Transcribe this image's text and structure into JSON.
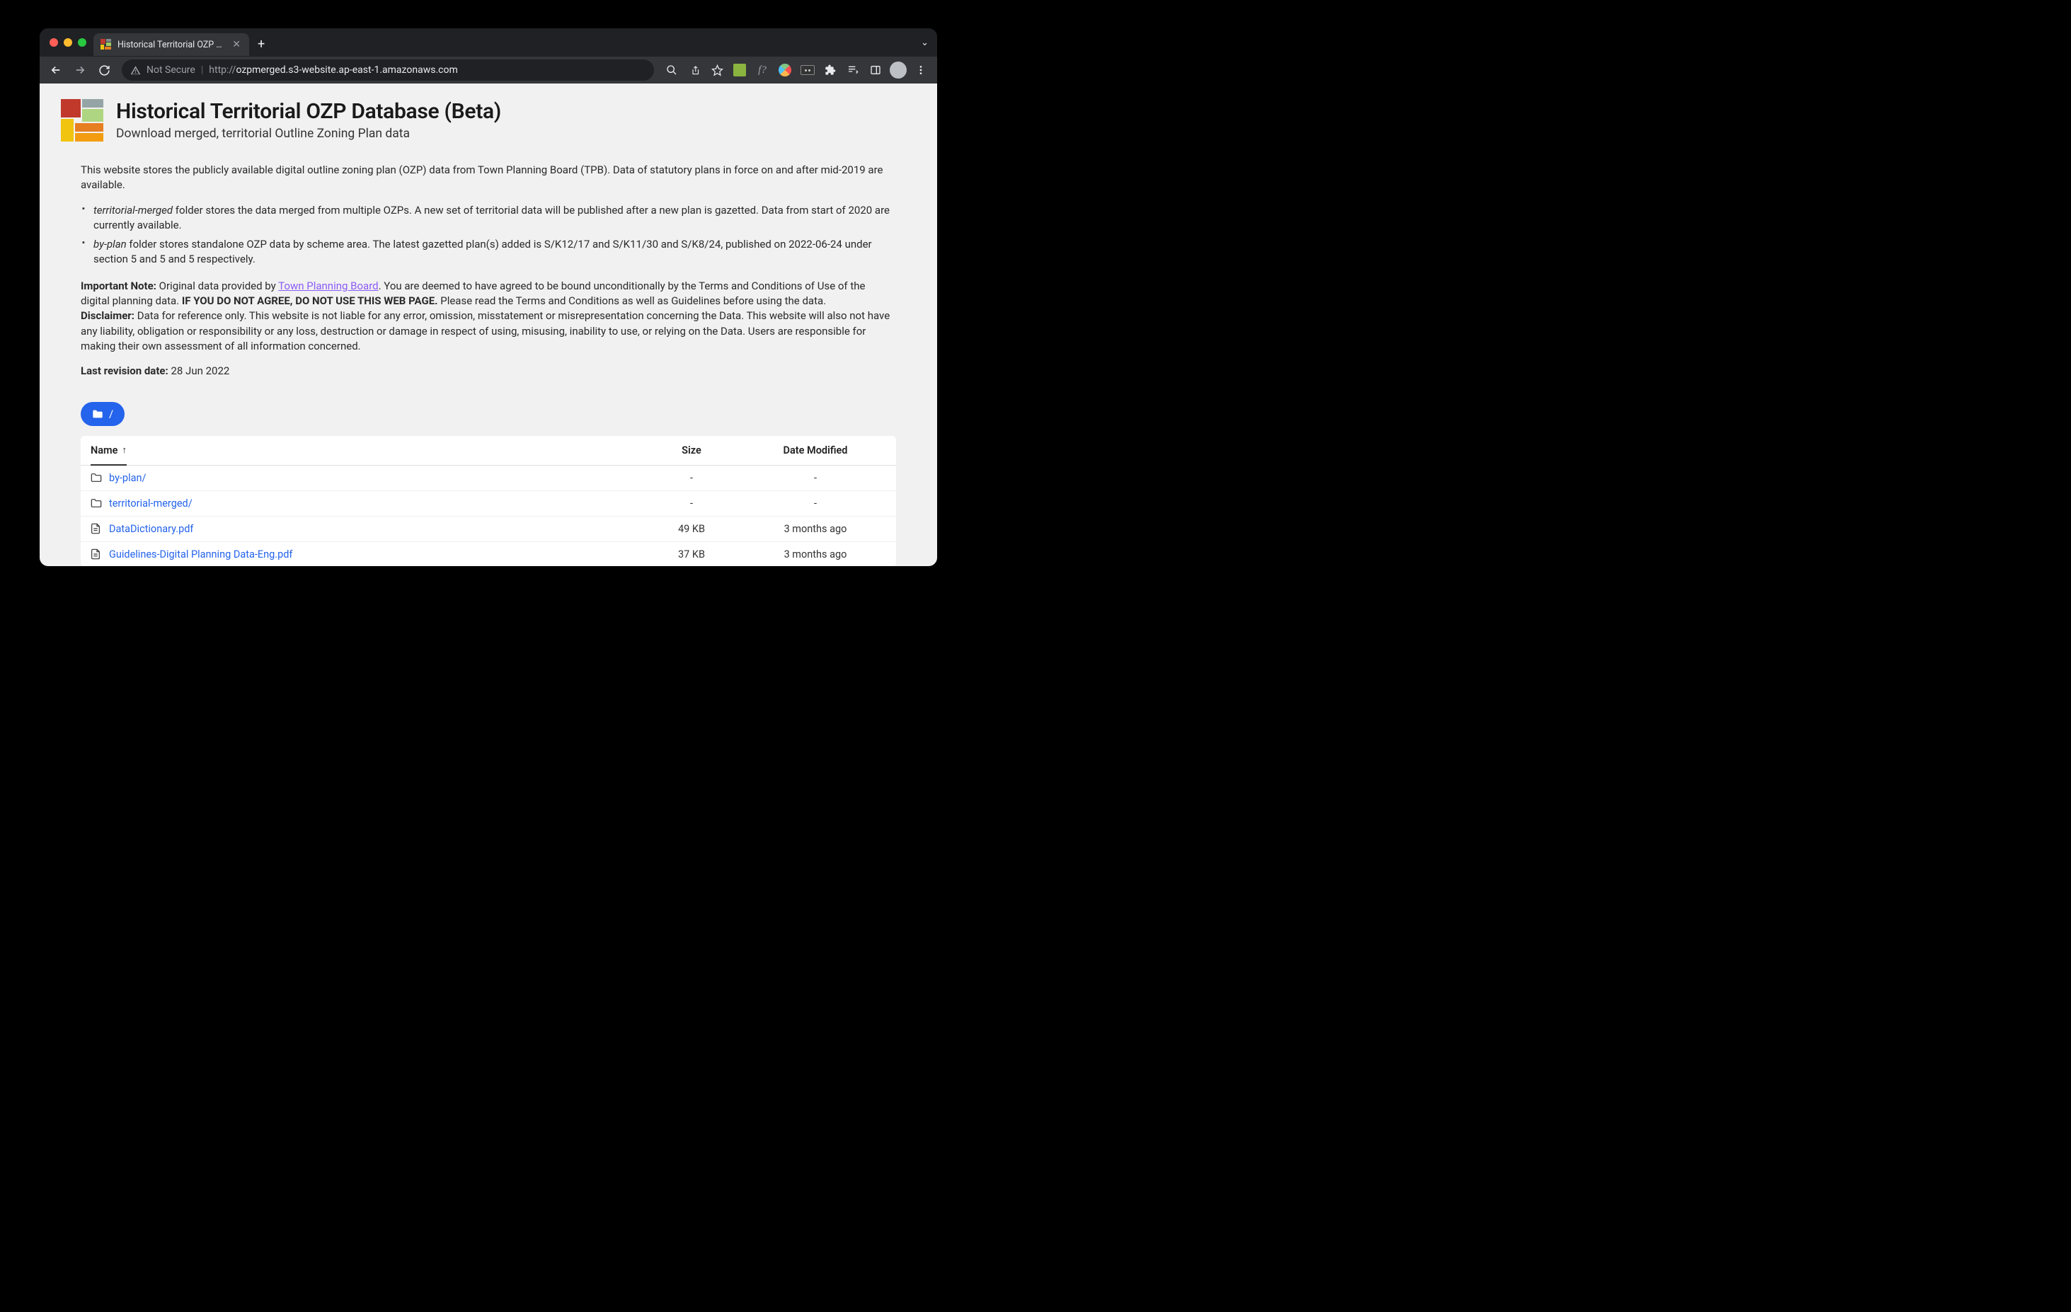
{
  "browser": {
    "tab_title": "Historical Territorial OZP Data…",
    "url_prefix": "http://",
    "url_host": "ozpmerged.s3-website.ap-east-1.amazonaws.com",
    "not_secure": "Not Secure"
  },
  "page": {
    "title": "Historical Territorial OZP Database (Beta)",
    "subtitle": "Download merged, territorial Outline Zoning Plan data",
    "intro": "This website stores the publicly available digital outline zoning plan (OZP) data from Town Planning Board (TPB). Data of statutory plans in force on and after mid-2019 are available.",
    "bullet1_em": "territorial-merged",
    "bullet1_rest": " folder stores the data merged from multiple OZPs. A new set of territorial data will be published after a new plan is gazetted. Data from start of 2020 are currently available.",
    "bullet2_em": "by-plan",
    "bullet2_rest": " folder stores standalone OZP data by scheme area. The latest gazetted plan(s) added is S/K12/17 and S/K11/30 and S/K8/24, published on 2022-06-24 under section 5 and 5 and 5 respectively.",
    "note_label": "Important Note:",
    "note_pre": " Original data provided by ",
    "note_link": "Town Planning Board",
    "note_post": ". You are deemed to have agreed to be bound unconditionally by the Terms and Conditions of Use of the digital planning data. ",
    "note_strong": "IF YOU DO NOT AGREE, DO NOT USE THIS WEB PAGE.",
    "note_tail": " Please read the Terms and Conditions as well as Guidelines before using the data.",
    "disclaimer_label": "Disclaimer:",
    "disclaimer_text": " Data for reference only. This website is not liable for any error, omission, misstatement or misrepresentation concerning the Data. This website will also not have any liability, obligation or responsibility or any loss, destruction or damage in respect of using, misusing, inability to use, or relying on the Data. Users are responsible for making their own assessment of all information concerned.",
    "revision_label": "Last revision date:",
    "revision_date": " 28 Jun 2022",
    "breadcrumb_root": "/"
  },
  "table": {
    "col_name": "Name",
    "col_size": "Size",
    "col_date": "Date Modified",
    "sort_arrow": "↑",
    "rows": [
      {
        "name": "by-plan/",
        "type": "folder",
        "size": "-",
        "date": "-"
      },
      {
        "name": "territorial-merged/",
        "type": "folder",
        "size": "-",
        "date": "-"
      },
      {
        "name": "DataDictionary.pdf",
        "type": "file",
        "size": "49 KB",
        "date": "3 months ago"
      },
      {
        "name": "Guidelines-Digital Planning Data-Eng.pdf",
        "type": "file",
        "size": "37 KB",
        "date": "3 months ago"
      }
    ]
  }
}
